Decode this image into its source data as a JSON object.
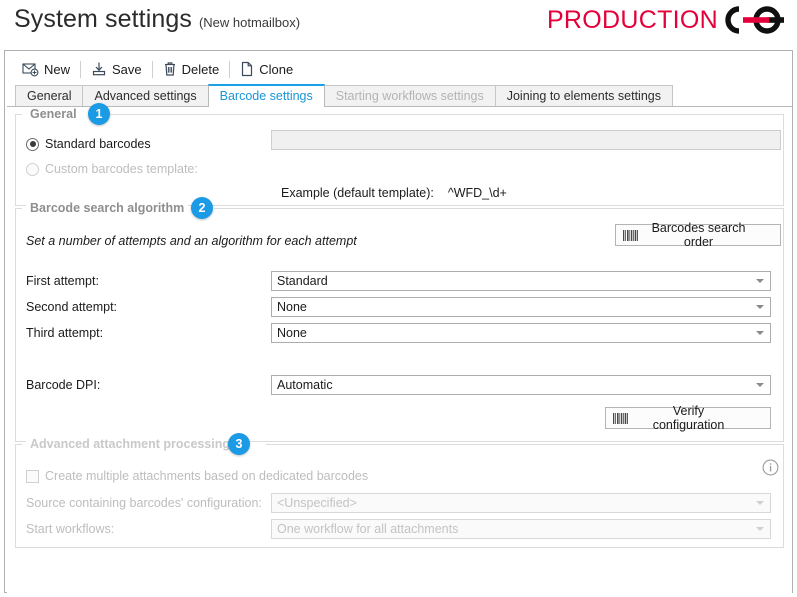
{
  "header": {
    "title": "System settings",
    "subtitle": "(New hotmailbox)",
    "logo_text": "PRODUCTION",
    "logo_accent_color": "#e4003a",
    "logo_mark_color": "#101010"
  },
  "toolbar": {
    "items": [
      {
        "label": "New",
        "icon": "new-mail-icon"
      },
      {
        "label": "Save",
        "icon": "save-icon"
      },
      {
        "label": "Delete",
        "icon": "trash-icon"
      },
      {
        "label": "Clone",
        "icon": "copy-icon"
      }
    ]
  },
  "tabs": [
    {
      "label": "General",
      "state": "normal"
    },
    {
      "label": "Advanced settings",
      "state": "normal"
    },
    {
      "label": "Barcode settings",
      "state": "active"
    },
    {
      "label": "Starting workflows settings",
      "state": "disabled"
    },
    {
      "label": "Joining to elements settings",
      "state": "normal"
    }
  ],
  "accent_color": "#1b9ae5",
  "groups": {
    "general": {
      "title": "General",
      "badge": "1",
      "standard_radio_label": "Standard barcodes",
      "standard_radio_checked": "true",
      "custom_radio_label": "Custom barcodes template:",
      "custom_radio_checked": "false",
      "custom_template_value": "",
      "custom_template_placeholder": "",
      "example_label": "Example (default template):",
      "example_value": "^WFD_\\d+"
    },
    "algorithm": {
      "title": "Barcode search algorithm",
      "badge": "2",
      "hint": "Set a number of attempts and an algorithm for each attempt",
      "search_order_button": "Barcodes search order",
      "first_attempt_label": "First attempt:",
      "first_attempt_value": "Standard",
      "second_attempt_label": "Second attempt:",
      "second_attempt_value": "None",
      "third_attempt_label": "Third attempt:",
      "third_attempt_value": "None",
      "dpi_label": "Barcode DPI:",
      "dpi_value": "Automatic",
      "verify_button": "Verify configuration"
    },
    "advanced": {
      "title": "Advanced attachment processing",
      "badge": "3",
      "checkbox_label": "Create multiple attachments based on dedicated barcodes",
      "checkbox_checked": "false",
      "source_label": "Source containing barcodes' configuration:",
      "source_value": "<Unspecified>",
      "workflows_label": "Start workflows:",
      "workflows_value": "One workflow for all attachments",
      "info_icon": "info-icon"
    }
  }
}
